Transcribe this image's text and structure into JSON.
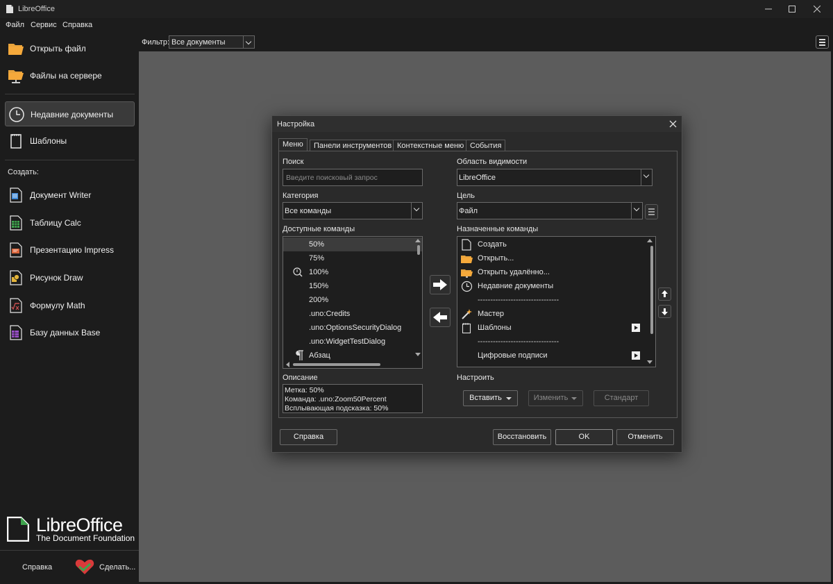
{
  "window": {
    "title": "LibreOffice"
  },
  "menubar": [
    "Файл",
    "Сервис",
    "Справка"
  ],
  "sidebar": {
    "open_file": "Открыть файл",
    "remote_files": "Файлы на сервере",
    "recent_docs": "Недавние документы",
    "templates": "Шаблоны",
    "create_label": "Создать:",
    "create_items": [
      "Документ Writer",
      "Таблицу Calc",
      "Презентацию Impress",
      "Рисунок Draw",
      "Формулу Math",
      "Базу данных Base"
    ],
    "logo_name": "LibreOffice",
    "logo_tagline": "The Document Foundation",
    "help": "Справка",
    "donate": "Сделать..."
  },
  "filter": {
    "label": "Фильтр:",
    "value": "Все документы"
  },
  "dialog": {
    "title": "Настройка",
    "tabs": [
      "Меню",
      "Панели инструментов",
      "Контекстные меню",
      "События"
    ],
    "search_label": "Поиск",
    "search_placeholder": "Введите поисковый запрос",
    "category_label": "Категория",
    "category_value": "Все команды",
    "available_label": "Доступные команды",
    "available": [
      "50%",
      "75%",
      "100%",
      "150%",
      "200%",
      ".uno:Credits",
      ".uno:OptionsSecurityDialog",
      ".uno:WidgetTestDialog",
      "Абзац"
    ],
    "scope_label": "Область видимости",
    "scope_value": "LibreOffice",
    "target_label": "Цель",
    "target_value": "Файл",
    "assigned_label": "Назначенные команды",
    "assigned": [
      "Создать",
      "Открыть...",
      "Открыть удалённо...",
      "Недавние документы",
      "--------------------------------",
      "Мастер",
      "Шаблоны",
      "--------------------------------",
      "Цифровые подписи"
    ],
    "description_label": "Описание",
    "description_lines": [
      "Метка: 50%",
      "Команда: .uno:Zoom50Percent",
      "Всплывающая подсказка: 50%"
    ],
    "customize_label": "Настроить",
    "insert_btn": "Вставить",
    "modify_btn": "Изменить",
    "default_btn": "Стандарт",
    "help_btn": "Справка",
    "reset_btn": "Восстановить",
    "ok_btn": "OK",
    "cancel_btn": "Отменить"
  }
}
